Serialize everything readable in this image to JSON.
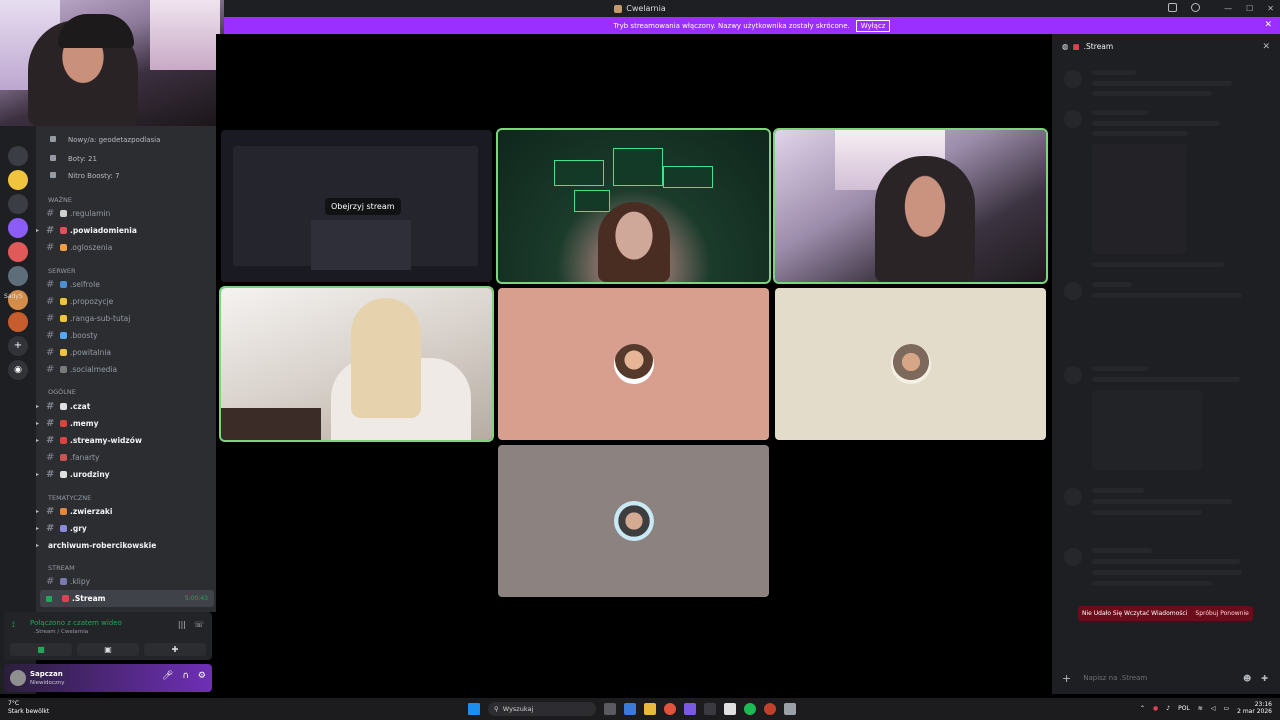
{
  "window": {
    "title": "Cwelarnia"
  },
  "banner": {
    "text": "Tryb streamowania włączony. Nazwy użytkownika zostały skrócone.",
    "button": "Wyłącz"
  },
  "server_sidebar": {
    "label": "SadyS"
  },
  "stats": [
    {
      "text": "Nowy/a: geodetazpodlasia"
    },
    {
      "text": "Boty: 21"
    },
    {
      "text": "Nitro Boosty: 7"
    }
  ],
  "categories": {
    "wazne": "WAŻNE",
    "serwer": "SERWER",
    "ogolne": "OGÓLNE",
    "tematyczne": "TEMATYCZNE",
    "stream": "STREAM"
  },
  "channels": {
    "regulamin": ".regulamin",
    "powiadomienia": ".powiadomienia",
    "ogloszenia": ".ogloszenia",
    "selfrole": ".selfrole",
    "propozycje": ".propozycje",
    "ranga": ".ranga-sub-tutaj",
    "boosty": ".boosty",
    "powitalnia": ".powitalnia",
    "socialmedia": ".socialmedia",
    "czat": ".czat",
    "memy": ".memy",
    "streamy": ".streamy-widzów",
    "fanarty": ".fanarty",
    "urodziny": ".urodziny",
    "zwierzaki": ".zwierzaki",
    "gry": ".gry",
    "archiwum": "archiwum-robercikowskie",
    "klipy": ".klipy",
    "stream": ".Stream",
    "stream_timer": "5:00:43"
  },
  "voice": {
    "connected": "Połączono z czatem wideo",
    "location": ".Stream / Cwelarnia"
  },
  "user": {
    "name": "Sapczan",
    "status": "Niewidoczny"
  },
  "stage": {
    "watch_stream": "Obejrzyj stream"
  },
  "chat": {
    "title": ".Stream",
    "error": "Nie Udało Się Wczytać Wiadomości",
    "retry": "Spróbuj Ponownie",
    "placeholder": "Napisz na .Stream"
  },
  "taskbar": {
    "weather_temp": "7°C",
    "weather_desc": "Stark bewölkt",
    "search": "Wyszukaj",
    "lang": "POL",
    "time": "23:16",
    "date": "2 mar 2026"
  },
  "colors": {
    "accent": "#9b2fff",
    "speaking": "#7ed37e",
    "online": "#23a55a",
    "error": "#6b0c1b"
  }
}
